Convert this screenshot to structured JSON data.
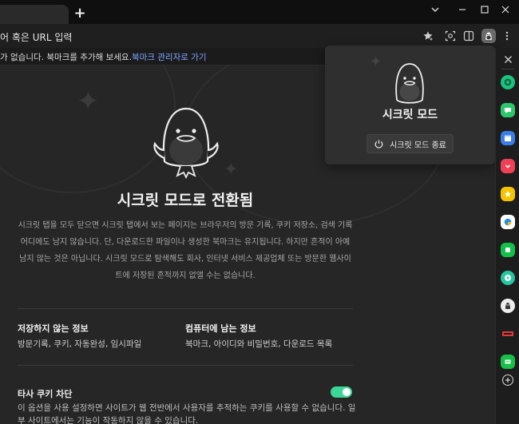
{
  "window": {
    "new_tab_label": "+",
    "controls": [
      "chevron-down-icon",
      "minimize-icon",
      "maximize-icon",
      "close-icon"
    ]
  },
  "toolbar": {
    "omnibox_text": "어 혹은 URL 입력",
    "icons": [
      "bookmark-add-icon",
      "screenshot-icon",
      "side-panel-icon",
      "incognito-profile-icon",
      "more-menu-icon"
    ]
  },
  "bookmark_bar": {
    "message": "가 없습니다. 북마크를 추가해 보세요.",
    "link": "북마크 관리자로 가기"
  },
  "page": {
    "title": "시크릿 모드로 전환됨",
    "description": "시크릿 탭을 모두 닫으면 시크릿 탭에서 보는 페이지는 브라우저의 방문 기록, 쿠키 저장소, 검색 기록 어디에도 남지 않습니다. 단, 다운로드한 파일이나 생성한 북마크는 유지됩니다. 하지만 흔적이 아예 남지 않는 것은 아닙니다. 시크릿 모드로 탐색해도 회사, 인터넷 서비스 제공업체 또는 방문한 웹사이트에 저장된 흔적까지 없앨 수는 없습니다.",
    "not_saved": {
      "title": "저장하지 않는 정보",
      "text": "방문기록, 쿠키, 자동완성, 임시파일"
    },
    "saved": {
      "title": "컴퓨터에 남는 정보",
      "text": "북마크, 아이디와 비밀번호, 다운로드 목록"
    },
    "third_party_cookie": {
      "title": "타사 쿠키 차단",
      "text": "이 옵션을 사용 설정하면 사이트가 웹 전반에서 사용자를 추적하는 쿠키를 사용할 수 없습니다. 일부 사이트에서는 기능이 작동하지 않을 수 있습니다.",
      "enabled": true
    }
  },
  "popup": {
    "title": "시크릿 모드",
    "button_label": "시크릿 모드 종료"
  },
  "sidebar": {
    "close_icon": "close-icon",
    "apps": [
      {
        "name": "green-circle-app-icon",
        "color": "#19c37d"
      },
      {
        "name": "chat-bubble-app-icon",
        "color": "#2ec66b"
      },
      {
        "name": "calendar-app-icon",
        "color": "#3d7de8"
      },
      {
        "name": "pocket-app-icon",
        "color": "#ef4056"
      },
      {
        "name": "star-app-icon",
        "color": "#f5c400"
      },
      {
        "name": "shopping-app-icon",
        "color": "#1f8ff0"
      },
      {
        "name": "green-square-app-icon",
        "color": "#12c04a"
      },
      {
        "name": "play-app-icon",
        "color": "#25c7a0"
      },
      {
        "name": "mascot-app-icon",
        "color": "#ededed"
      },
      {
        "name": "news-app-icon",
        "color": "#e23b3b"
      },
      {
        "name": "webtoon-app-icon",
        "color": "#18c04a"
      }
    ],
    "add_icon": "add-icon"
  },
  "colors": {
    "page_background": "#262626",
    "accent_link": "#7fa7ff",
    "toggle_on": "#3cd699"
  }
}
